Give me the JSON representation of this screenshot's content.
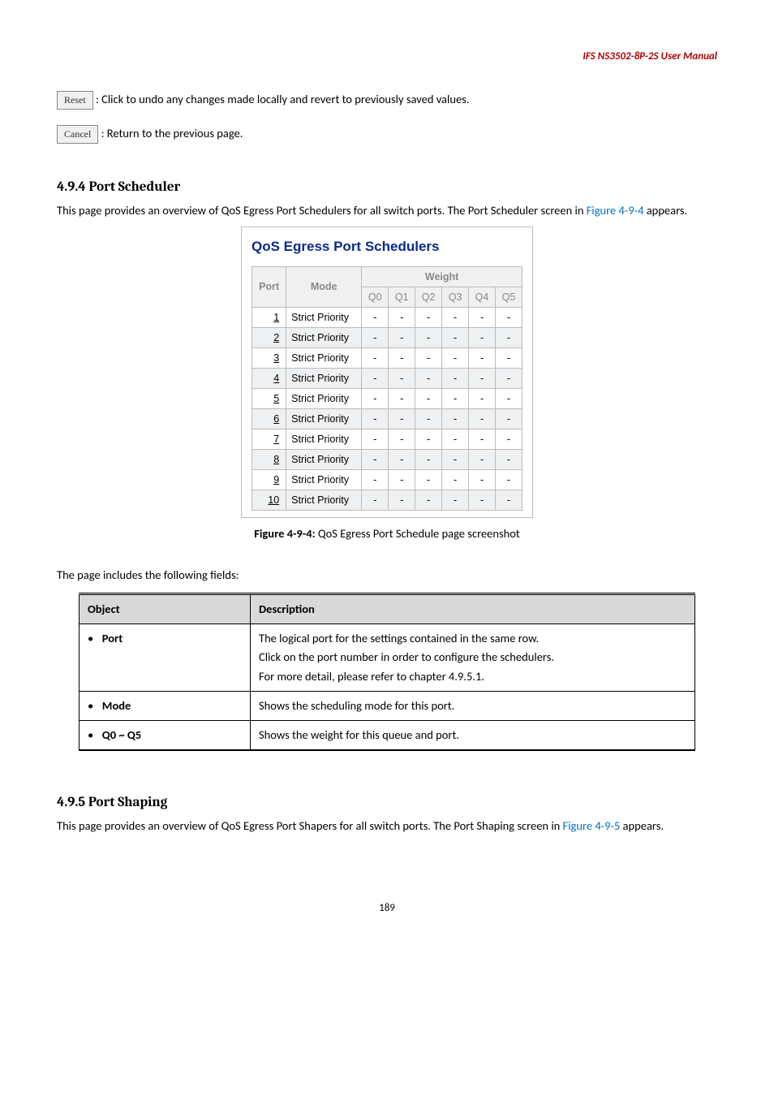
{
  "header": {
    "manual_title": "IFS NS3502-8P-2S  User  Manual"
  },
  "buttons": {
    "reset_label": "Reset",
    "reset_desc": ": Click to undo any changes made locally and revert to previously saved values.",
    "cancel_label": "Cancel",
    "cancel_desc": ": Return to the previous page."
  },
  "section_scheduler": {
    "heading": "4.9.4 Port Scheduler",
    "intro_pre": "This page provides an overview of QoS Egress Port Schedulers for all switch ports. The Port Scheduler screen in ",
    "intro_figref": "Figure 4-9-4",
    "intro_post": " appears.",
    "panel_title": "QoS Egress Port Schedulers",
    "col_port": "Port",
    "col_mode": "Mode",
    "col_weight": "Weight",
    "weight_cols": [
      "Q0",
      "Q1",
      "Q2",
      "Q3",
      "Q4",
      "Q5"
    ],
    "rows": [
      {
        "port": "1",
        "mode": "Strict Priority",
        "w": [
          "-",
          "-",
          "-",
          "-",
          "-",
          "-"
        ]
      },
      {
        "port": "2",
        "mode": "Strict Priority",
        "w": [
          "-",
          "-",
          "-",
          "-",
          "-",
          "-"
        ]
      },
      {
        "port": "3",
        "mode": "Strict Priority",
        "w": [
          "-",
          "-",
          "-",
          "-",
          "-",
          "-"
        ]
      },
      {
        "port": "4",
        "mode": "Strict Priority",
        "w": [
          "-",
          "-",
          "-",
          "-",
          "-",
          "-"
        ]
      },
      {
        "port": "5",
        "mode": "Strict Priority",
        "w": [
          "-",
          "-",
          "-",
          "-",
          "-",
          "-"
        ]
      },
      {
        "port": "6",
        "mode": "Strict Priority",
        "w": [
          "-",
          "-",
          "-",
          "-",
          "-",
          "-"
        ]
      },
      {
        "port": "7",
        "mode": "Strict Priority",
        "w": [
          "-",
          "-",
          "-",
          "-",
          "-",
          "-"
        ]
      },
      {
        "port": "8",
        "mode": "Strict Priority",
        "w": [
          "-",
          "-",
          "-",
          "-",
          "-",
          "-"
        ]
      },
      {
        "port": "9",
        "mode": "Strict Priority",
        "w": [
          "-",
          "-",
          "-",
          "-",
          "-",
          "-"
        ]
      },
      {
        "port": "10",
        "mode": "Strict Priority",
        "w": [
          "-",
          "-",
          "-",
          "-",
          "-",
          "-"
        ]
      }
    ],
    "caption_label": "Figure 4-9-4:",
    "caption_text": " QoS Egress Port Schedule page screenshot"
  },
  "fields_table": {
    "intro": "The page includes the following fields:",
    "head_object": "Object",
    "head_desc": "Description",
    "rows": [
      {
        "object": "Port",
        "desc_lines": [
          "The logical port for the settings contained in the same row.",
          "Click on the port number in order to configure the schedulers.",
          "For more detail, please refer to chapter 4.9.5.1."
        ]
      },
      {
        "object": "Mode",
        "desc_lines": [
          "Shows the scheduling mode for this port."
        ]
      },
      {
        "object": "Q0 ~ Q5",
        "desc_lines": [
          "Shows the weight for this queue and port."
        ]
      }
    ]
  },
  "section_shaping": {
    "heading": "4.9.5 Port Shaping",
    "intro_pre": "This page provides an overview of QoS Egress Port Shapers for all switch ports. The Port Shaping screen in ",
    "intro_figref": "Figure 4-9-5",
    "intro_post": " appears."
  },
  "page_number": "189"
}
